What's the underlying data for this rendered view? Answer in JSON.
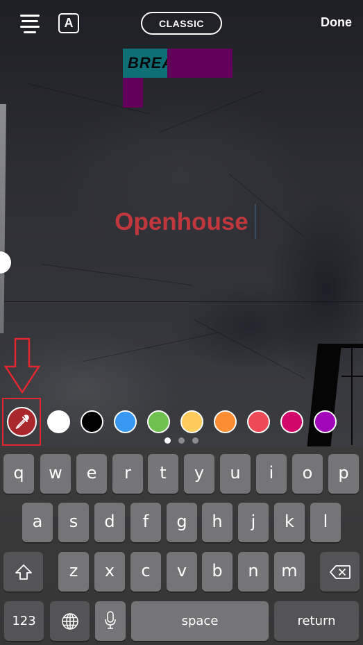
{
  "topbar": {
    "align_icon": "align-center-icon",
    "font_style_label": "A",
    "font_style_icon": "text-style-icon",
    "font_name": "CLASSIC",
    "done_label": "Done"
  },
  "stickers": {
    "teal_sticker_text": "BREA",
    "teal_color": "#0e6f74",
    "purple_color": "#620059"
  },
  "text_editor": {
    "content": "Openhouse",
    "text_color": "#c0383e"
  },
  "size_slider": {
    "icon": "text-size-slider",
    "value_fraction": 0.69
  },
  "annotation": {
    "arrow": "down-arrow-annotation",
    "highlight_color": "#e3262f"
  },
  "palette": {
    "eyedropper_icon": "eyedropper-icon",
    "eyedropper_selected_color": "#a8282e",
    "colors": [
      {
        "name": "white",
        "hex": "#ffffff"
      },
      {
        "name": "black",
        "hex": "#000000"
      },
      {
        "name": "blue",
        "hex": "#3897f0"
      },
      {
        "name": "green",
        "hex": "#70c050"
      },
      {
        "name": "yellow",
        "hex": "#fdcb5c"
      },
      {
        "name": "orange",
        "hex": "#fd8d32"
      },
      {
        "name": "red",
        "hex": "#ed4956"
      },
      {
        "name": "magenta",
        "hex": "#d10869"
      },
      {
        "name": "purple",
        "hex": "#a307ba"
      }
    ],
    "pages": 3,
    "active_page": 1
  },
  "keyboard": {
    "row1": [
      "q",
      "w",
      "e",
      "r",
      "t",
      "y",
      "u",
      "i",
      "o",
      "p"
    ],
    "row2": [
      "a",
      "s",
      "d",
      "f",
      "g",
      "h",
      "j",
      "k",
      "l"
    ],
    "row3": [
      "z",
      "x",
      "c",
      "v",
      "b",
      "n",
      "m"
    ],
    "shift_icon": "shift-icon",
    "delete_icon": "backspace-icon",
    "numbers_label": "123",
    "globe_icon": "globe-icon",
    "mic_icon": "microphone-icon",
    "space_label": "space",
    "return_label": "return"
  }
}
